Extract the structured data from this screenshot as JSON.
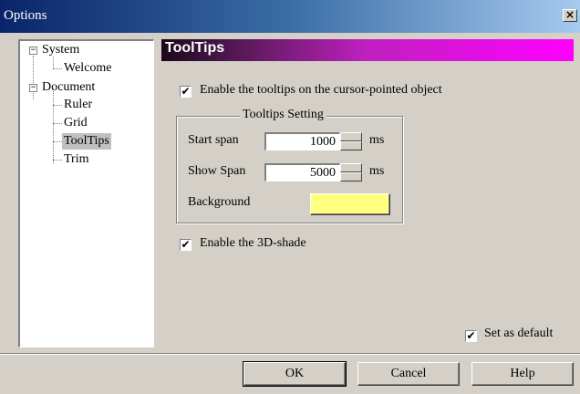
{
  "window": {
    "title": "Options",
    "close_glyph": "×"
  },
  "tree": {
    "nodes": [
      {
        "label": "System",
        "expander": "−"
      },
      {
        "label": "Welcome"
      },
      {
        "label": "Document",
        "expander": "−"
      },
      {
        "label": "Ruler"
      },
      {
        "label": "Grid"
      },
      {
        "label": "ToolTips",
        "selected": true
      },
      {
        "label": "Trim"
      }
    ]
  },
  "panel": {
    "title": "ToolTips",
    "enable_tooltips": {
      "label": "Enable the tooltips on the cursor-pointed object",
      "checked": true,
      "mark": "✔"
    },
    "group": {
      "title": "Tooltips Setting",
      "start_span": {
        "label": "Start span",
        "value": "1000",
        "unit": "ms"
      },
      "show_span": {
        "label": "Show Span",
        "value": "5000",
        "unit": "ms"
      },
      "background": {
        "label": "Background",
        "color": "#ffff80"
      }
    },
    "enable_3d": {
      "label": "Enable the 3D-shade",
      "checked": true,
      "mark": "✔"
    },
    "set_default": {
      "label": "Set as default",
      "checked": true,
      "mark": "✔"
    }
  },
  "buttons": {
    "ok": "OK",
    "cancel": "Cancel",
    "help": "Help"
  }
}
